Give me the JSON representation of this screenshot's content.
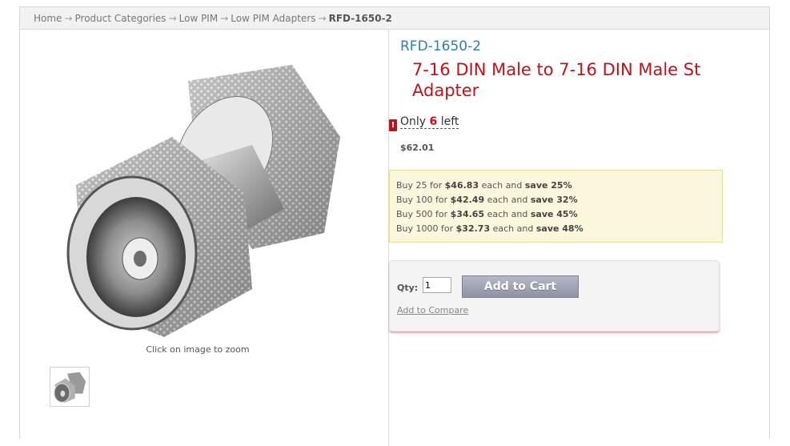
{
  "breadcrumb": {
    "items": [
      "Home",
      "Product Categories",
      "Low PIM",
      "Low PIM Adapters"
    ],
    "current": "RFD-1650-2",
    "separator": "→"
  },
  "product": {
    "sku": "RFD-1650-2",
    "title": "7-16 DIN Male to 7-16 DIN Male St Adapter",
    "stock_prefix": "Only",
    "stock_count": "6",
    "stock_suffix": "left",
    "warning_icon": "!",
    "price": "$62.01",
    "zoom_caption": "Click on image to zoom"
  },
  "tier_pricing": [
    {
      "qty": "25",
      "price": "$46.83",
      "save": "save 25%"
    },
    {
      "qty": "100",
      "price": "$42.49",
      "save": "save 32%"
    },
    {
      "qty": "500",
      "price": "$34.65",
      "save": "save 45%"
    },
    {
      "qty": "1000",
      "price": "$32.73",
      "save": "save 48%"
    }
  ],
  "tier_words": {
    "buy": "Buy",
    "for": "for",
    "each_and": "each and"
  },
  "cart": {
    "qty_label": "Qty:",
    "qty_value": "1",
    "add_button": "Add to Cart",
    "compare_link": "Add to Compare"
  },
  "colors": {
    "title": "#c0121a",
    "sku": "#2f7fa8",
    "tier_bg": "#fbf7dd"
  }
}
